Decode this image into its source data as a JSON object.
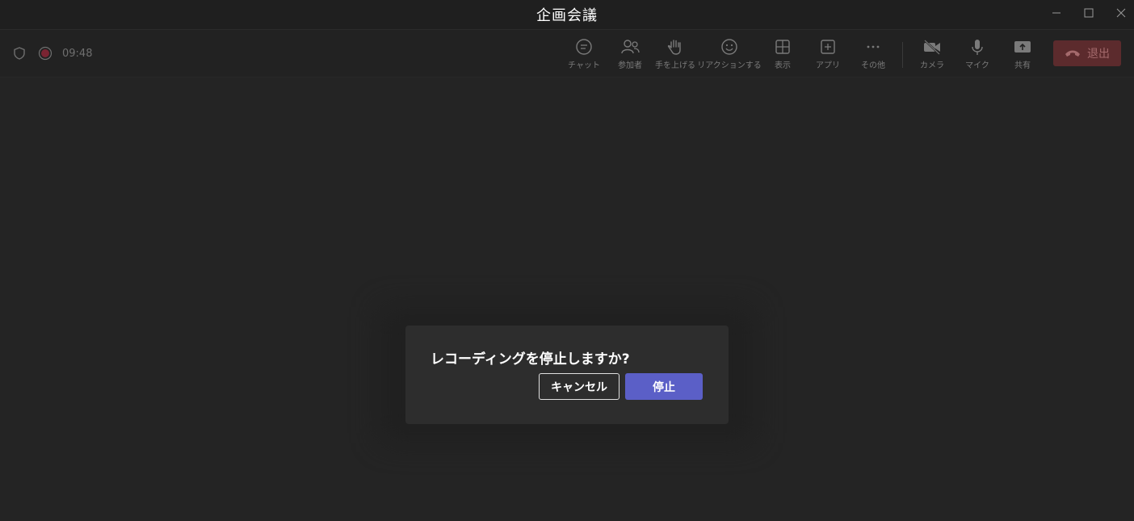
{
  "window": {
    "title": "企画会議"
  },
  "toolbar": {
    "timer": "09:48",
    "items": [
      {
        "label": "チャット",
        "icon": "chat-icon"
      },
      {
        "label": "参加者",
        "icon": "people-icon"
      },
      {
        "label": "手を上げる",
        "icon": "raise-hand-icon"
      },
      {
        "label": "リアクションする",
        "icon": "smiley-icon"
      },
      {
        "label": "表示",
        "icon": "grid-view-icon"
      },
      {
        "label": "アプリ",
        "icon": "add-app-icon"
      },
      {
        "label": "その他",
        "icon": "more-icon"
      },
      {
        "label": "カメラ",
        "icon": "camera-off-icon"
      },
      {
        "label": "マイク",
        "icon": "mic-icon"
      },
      {
        "label": "共有",
        "icon": "share-icon"
      }
    ],
    "leave_label": "退出"
  },
  "dialog": {
    "title": "レコーディングを停止しますか?",
    "cancel_label": "キャンセル",
    "stop_label": "停止"
  },
  "colors": {
    "background": "#242424",
    "primary_button": "#5b5fc7",
    "leave_button": "#5c2b2d",
    "record_dot": "#c4314b"
  }
}
